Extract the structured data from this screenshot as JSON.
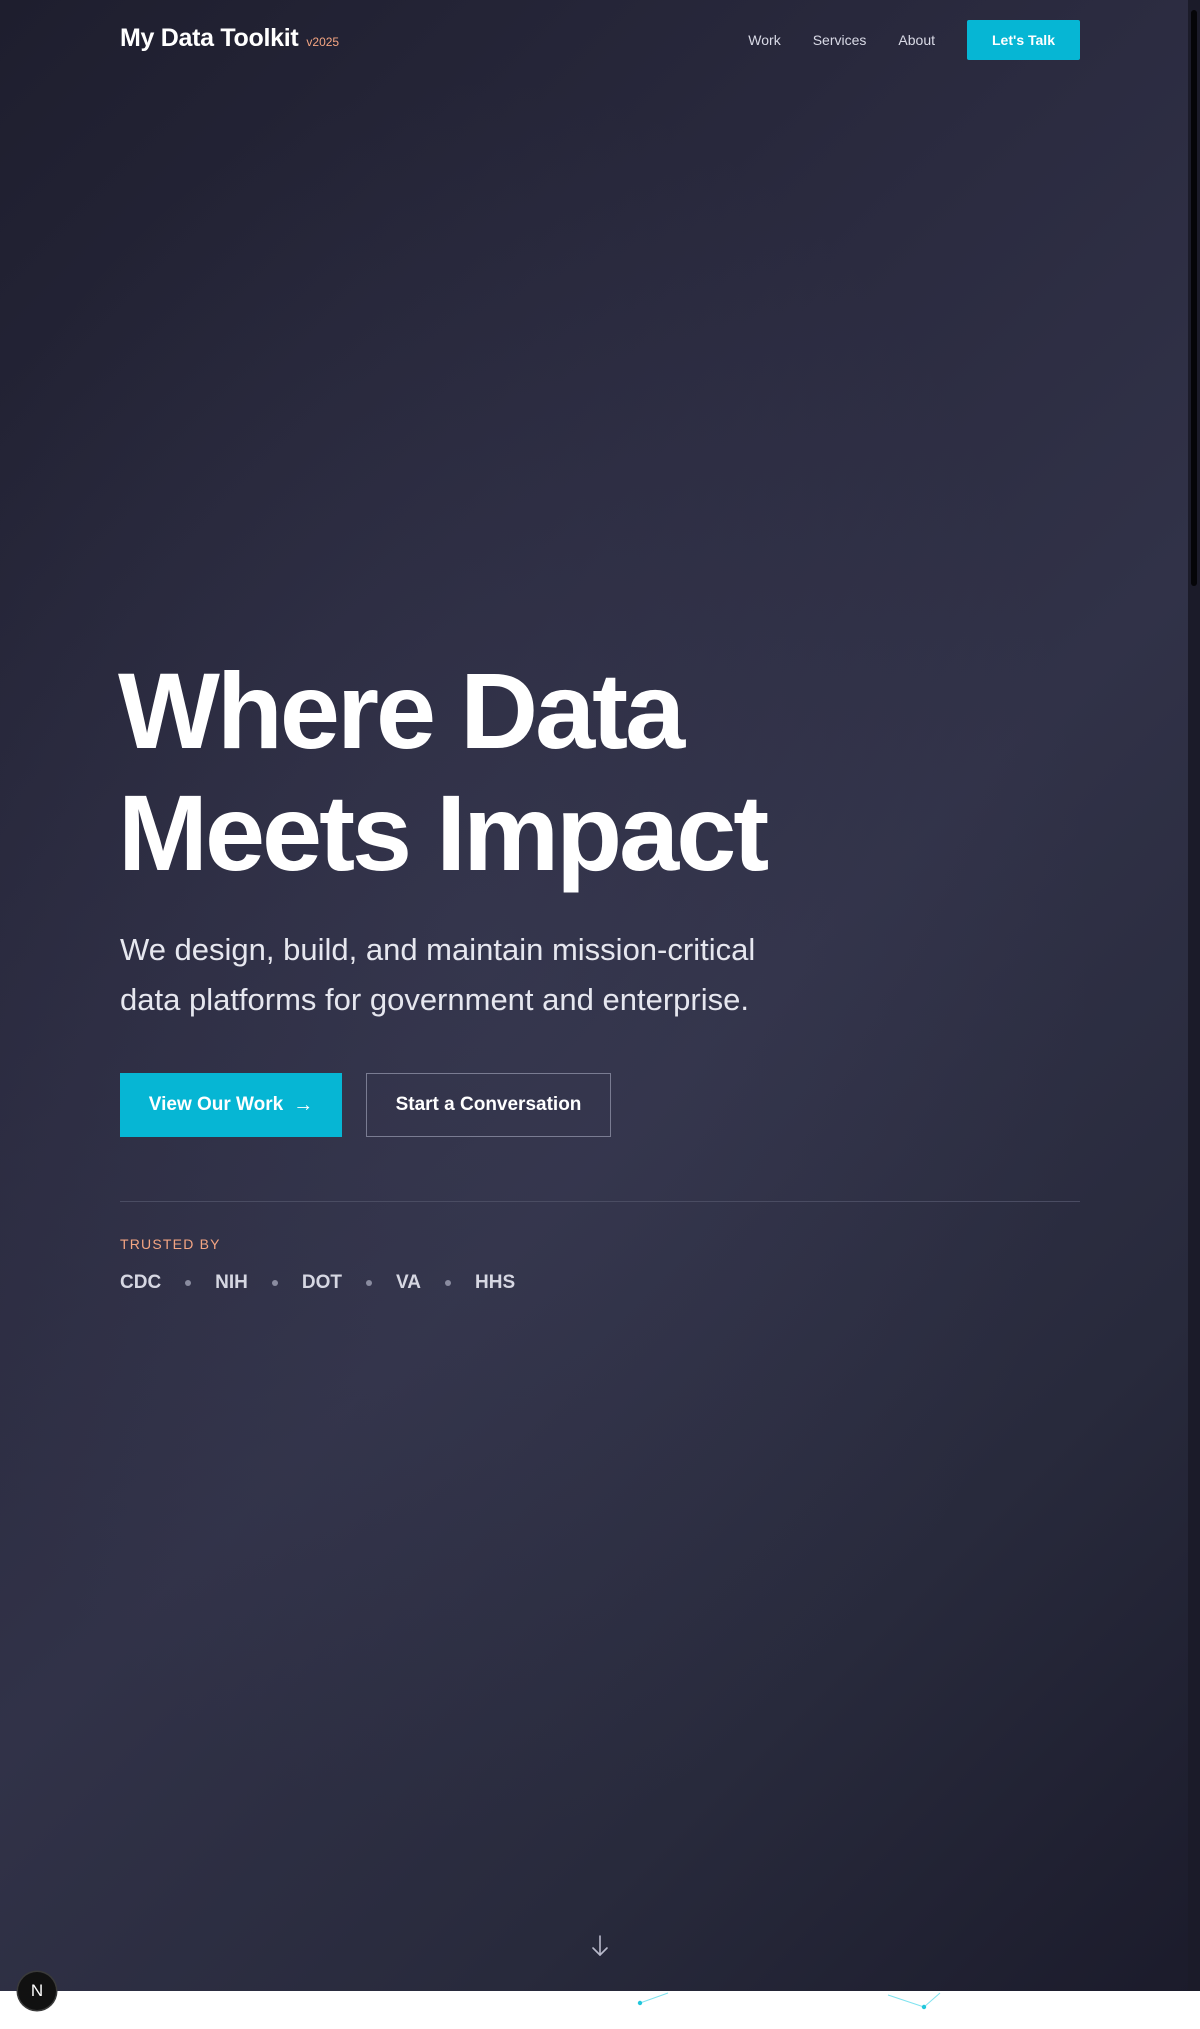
{
  "brand": {
    "name": "My Data Toolkit",
    "version": "v2025"
  },
  "nav": {
    "links": [
      "Work",
      "Services",
      "About"
    ],
    "cta": "Let's Talk"
  },
  "hero": {
    "headline_line1": "Where Data",
    "headline_line2": "Meets Impact",
    "subheadline": "We design, build, and maintain mission-critical data platforms for government and enterprise.",
    "primary_cta": "View Our Work",
    "secondary_cta": "Start a Conversation"
  },
  "trusted": {
    "label": "TRUSTED BY",
    "clients": [
      "CDC",
      "NIH",
      "DOT",
      "VA",
      "HHS"
    ]
  },
  "dev_badge": {
    "letter": "N"
  },
  "icons": {
    "primary_cta_icon": "arrow-right-icon",
    "scroll_icon": "arrow-down-icon"
  },
  "colors": {
    "accent": "#06b6d4",
    "highlight": "#f4a582",
    "background": "#2b2b40"
  }
}
